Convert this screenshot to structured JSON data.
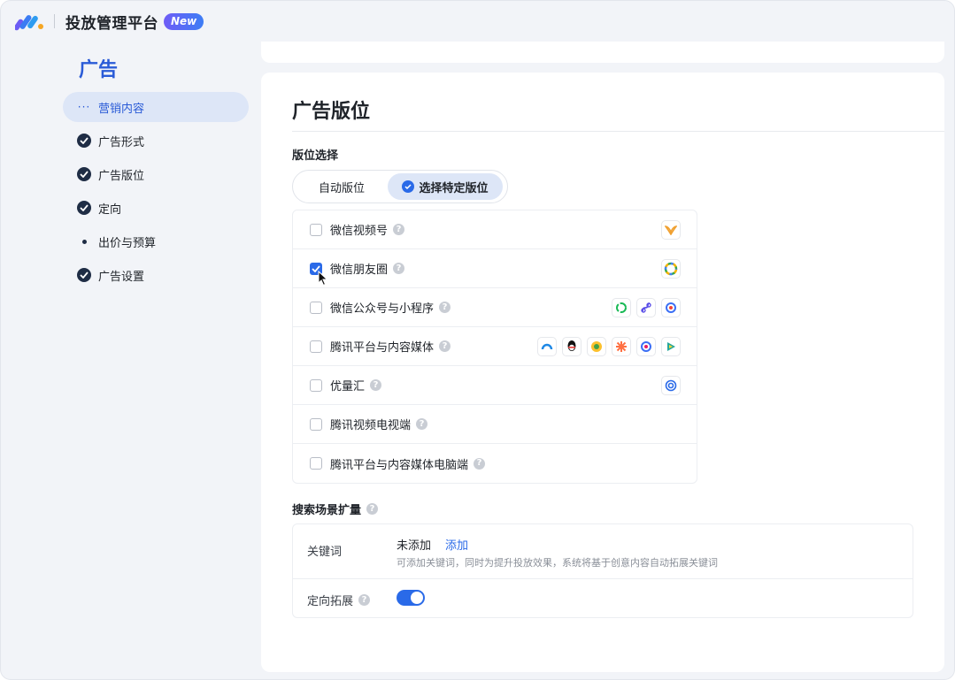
{
  "header": {
    "app_title": "投放管理平台",
    "badge": "New"
  },
  "sidebar": {
    "title": "广告",
    "items": [
      {
        "label": "营销内容",
        "state": "active"
      },
      {
        "label": "广告形式",
        "state": "done"
      },
      {
        "label": "广告版位",
        "state": "done"
      },
      {
        "label": "定向",
        "state": "done"
      },
      {
        "label": "出价与预算",
        "state": "pending"
      },
      {
        "label": "广告设置",
        "state": "done"
      }
    ]
  },
  "main": {
    "title": "广告版位",
    "placement_select_label": "版位选择",
    "segment": {
      "auto": "自动版位",
      "specific": "选择特定版位",
      "selected": "specific"
    },
    "placements": [
      {
        "label": "微信视频号",
        "checked": false,
        "icons": [
          "wechat-channels-icon"
        ]
      },
      {
        "label": "微信朋友圈",
        "checked": true,
        "icons": [
          "wechat-moments-icon"
        ]
      },
      {
        "label": "微信公众号与小程序",
        "checked": false,
        "icons": [
          "wechat-official-account-icon",
          "mini-program-icon",
          "wechat-search-icon"
        ]
      },
      {
        "label": "腾讯平台与内容媒体",
        "checked": false,
        "icons": [
          "tencent-news-icon",
          "qq-icon",
          "qq-browser-icon",
          "tencent-sports-icon",
          "tencent-video-icon",
          "tencent-video-play-icon"
        ]
      },
      {
        "label": "优量汇",
        "checked": false,
        "icons": [
          "youlianghui-icon"
        ]
      },
      {
        "label": "腾讯视频电视端",
        "checked": false,
        "icons": []
      },
      {
        "label": "腾讯平台与内容媒体电脑端",
        "checked": false,
        "icons": []
      }
    ],
    "search_scene": {
      "label": "搜索场景扩量",
      "keyword_label": "关键词",
      "keyword_status": "未添加",
      "keyword_add": "添加",
      "keyword_hint": "可添加关键词，同时为提升投放效果，系统将基于创意内容自动拓展关键词",
      "extension_label": "定向拓展",
      "extension_on": true
    }
  },
  "colors": {
    "accent": "#2a6ae8",
    "sidebar_title": "#2a5bd7",
    "active_bg": "#dde6f7"
  }
}
